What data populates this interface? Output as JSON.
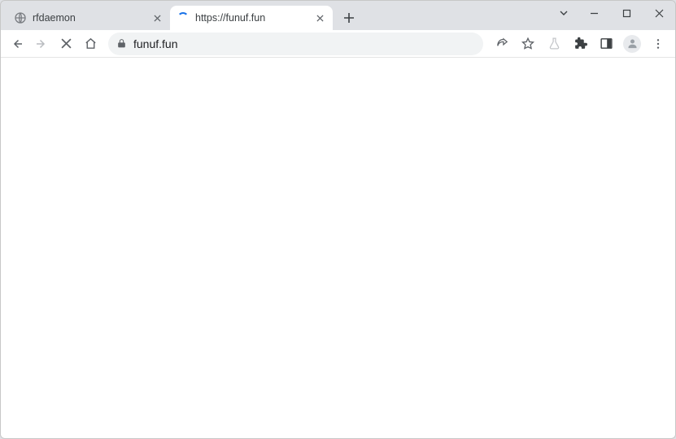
{
  "tabs": [
    {
      "title": "rfdaemon",
      "active": false,
      "loading": false
    },
    {
      "title": "https://funuf.fun",
      "active": true,
      "loading": true
    }
  ],
  "addressbar": {
    "url": "funuf.fun"
  }
}
